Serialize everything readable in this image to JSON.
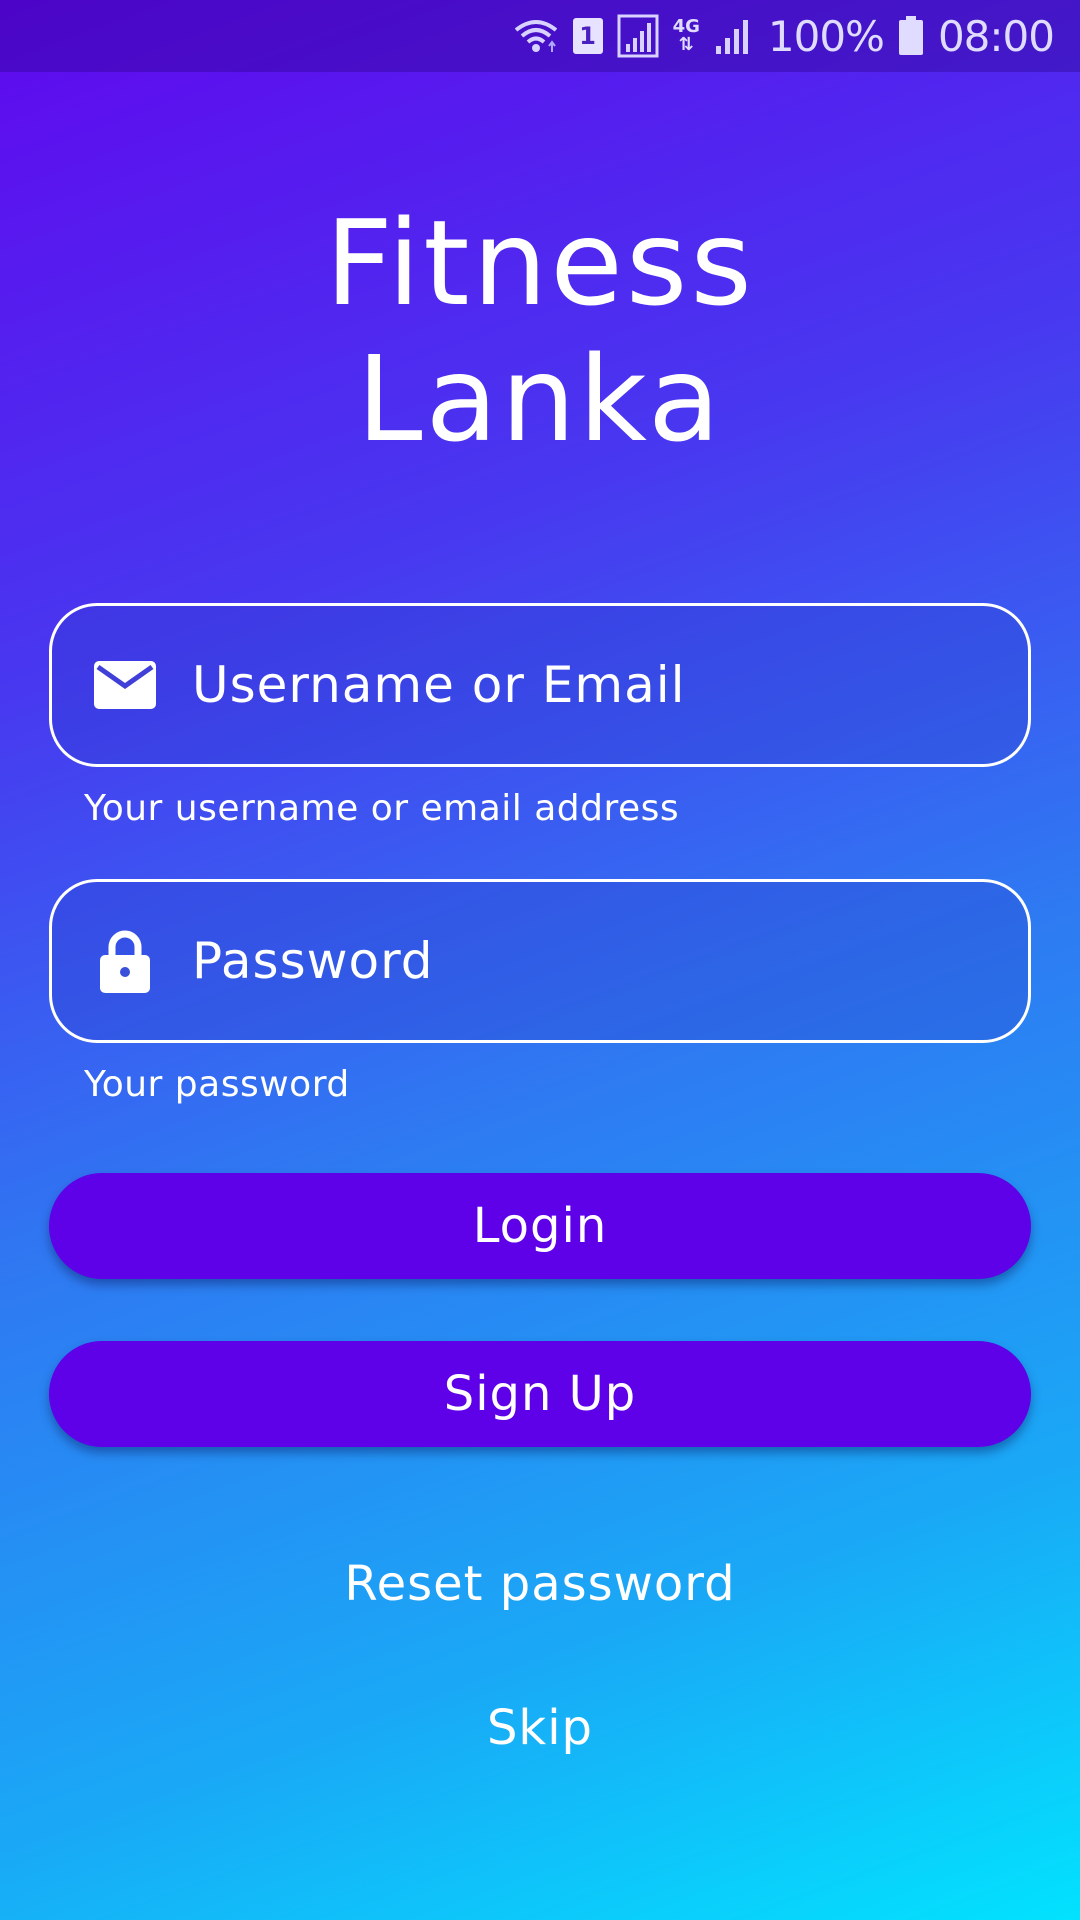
{
  "status_bar": {
    "wifi_icon": "wifi-icon",
    "sim_badge": "1",
    "network_type": "4G",
    "battery": "100%",
    "time": "08:00"
  },
  "app": {
    "title_line1": "Fitness",
    "title_line2": "Lanka"
  },
  "form": {
    "username": {
      "icon": "mail-icon",
      "placeholder": "Username or Email",
      "helper": "Your username or email address"
    },
    "password": {
      "icon": "lock-icon",
      "placeholder": "Password",
      "helper": "Your password"
    }
  },
  "buttons": {
    "login": "Login",
    "signup": "Sign Up"
  },
  "links": {
    "reset": "Reset password",
    "skip": "Skip"
  },
  "colors": {
    "button": "#5e00e8",
    "gradient_top": "#6008ee",
    "gradient_bottom": "#02e2fe"
  }
}
